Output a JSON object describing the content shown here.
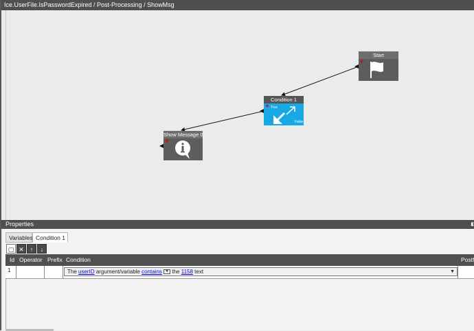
{
  "window": {
    "title": "Ice.UserFile.IsPasswordExpired / Post-Processing / ShowMsg"
  },
  "nodes": {
    "start": {
      "label": "Start"
    },
    "condition": {
      "label": "Condition 1",
      "true_label": "True",
      "false_label": "False"
    },
    "message": {
      "label": "Show Message 0"
    }
  },
  "properties": {
    "title": "Properties",
    "tabs": [
      {
        "label": "Variables"
      },
      {
        "label": "Condition 1"
      }
    ],
    "toolbar": {
      "new": "new-icon",
      "delete": "delete-icon",
      "up": "arrow-up-icon",
      "down": "arrow-down-icon"
    },
    "grid": {
      "columns": [
        "Id",
        "Operator",
        "Prefix",
        "Condition",
        "Postfix"
      ],
      "rows": [
        {
          "id": "1",
          "operator": "",
          "prefix": "",
          "condition": {
            "t1": "The",
            "var": "userID",
            "t2": "argument/variable",
            "op": "contains",
            "t3": "the",
            "val": "1158",
            "t4": "text"
          },
          "postfix": ""
        }
      ]
    }
  },
  "colors": {
    "accent": "#18a8e6",
    "node": "#5d5d5d",
    "bar": "#4f4f4f"
  }
}
